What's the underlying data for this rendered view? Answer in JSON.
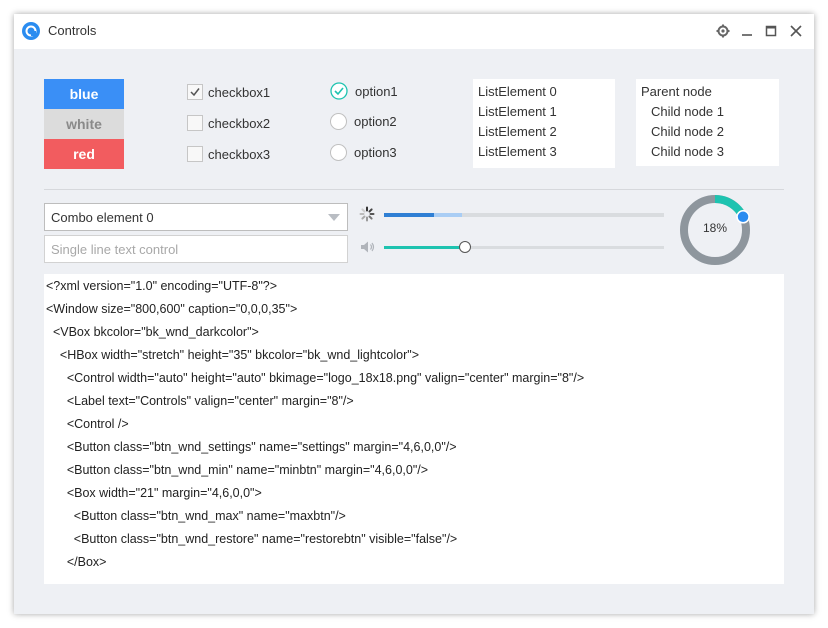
{
  "window": {
    "title": "Controls",
    "icons": {
      "logo": "app-logo-icon",
      "settings": "gear-icon",
      "minimize": "minimize-icon",
      "maximize": "maximize-icon",
      "close": "close-icon"
    }
  },
  "buttons": [
    {
      "label": "blue",
      "color": "#3a8ff6"
    },
    {
      "label": "white",
      "color": "#dcdcdc",
      "text_color": "#8a8a8a"
    },
    {
      "label": "red",
      "color": "#f25c5f"
    }
  ],
  "checkboxes": [
    {
      "label": "checkbox1",
      "checked": true
    },
    {
      "label": "checkbox2",
      "checked": false
    },
    {
      "label": "checkbox3",
      "checked": false
    }
  ],
  "radios": [
    {
      "label": "option1",
      "selected": true
    },
    {
      "label": "option2",
      "selected": false
    },
    {
      "label": "option3",
      "selected": false
    }
  ],
  "list": [
    "ListElement 0",
    "ListElement 1",
    "ListElement 2",
    "ListElement 3"
  ],
  "tree": {
    "parent": "Parent node",
    "children": [
      "Child node 1",
      "Child node 2",
      "Child node 3"
    ]
  },
  "combo": {
    "value": "Combo element 0"
  },
  "edit": {
    "placeholder": "Single line text control"
  },
  "progress": {
    "value": 0.18,
    "buffer": 0.1,
    "label": "18%"
  },
  "volume_slider": {
    "value": 0.29
  },
  "accent_color": "#1ec3b0",
  "code_lines": [
    "<?xml version=\"1.0\" encoding=\"UTF-8\"?>",
    "<Window size=\"800,600\" caption=\"0,0,0,35\">",
    "  <VBox bkcolor=\"bk_wnd_darkcolor\">",
    "    <HBox width=\"stretch\" height=\"35\" bkcolor=\"bk_wnd_lightcolor\">",
    "      <Control width=\"auto\" height=\"auto\" bkimage=\"logo_18x18.png\" valign=\"center\" margin=\"8\"/>",
    "      <Label text=\"Controls\" valign=\"center\" margin=\"8\"/>",
    "      <Control />",
    "      <Button class=\"btn_wnd_settings\" name=\"settings\" margin=\"4,6,0,0\"/>",
    "      <Button class=\"btn_wnd_min\" name=\"minbtn\" margin=\"4,6,0,0\"/>",
    "      <Box width=\"21\" margin=\"4,6,0,0\">",
    "        <Button class=\"btn_wnd_max\" name=\"maxbtn\"/>",
    "        <Button class=\"btn_wnd_restore\" name=\"restorebtn\" visible=\"false\"/>",
    "      </Box>"
  ]
}
